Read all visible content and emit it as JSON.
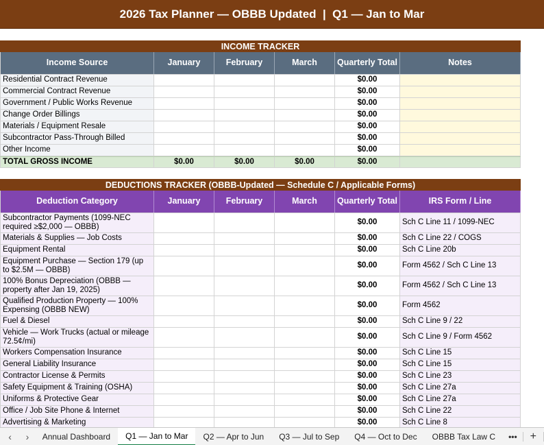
{
  "title": "2026 Tax Planner — OBBB Updated  |  Q1 — Jan to Mar",
  "income": {
    "section_title": "INCOME TRACKER",
    "headers": [
      "Income Source",
      "January",
      "February",
      "March",
      "Quarterly Total",
      "Notes"
    ],
    "rows": [
      {
        "label": "Residential Contract Revenue",
        "total": "$0.00"
      },
      {
        "label": "Commercial Contract Revenue",
        "total": "$0.00"
      },
      {
        "label": "Government / Public Works Revenue",
        "total": "$0.00"
      },
      {
        "label": "Change Order Billings",
        "total": "$0.00"
      },
      {
        "label": "Materials / Equipment Resale",
        "total": "$0.00"
      },
      {
        "label": "Subcontractor Pass-Through Billed",
        "total": "$0.00"
      },
      {
        "label": "Other Income",
        "total": "$0.00"
      }
    ],
    "total_row": {
      "label": "TOTAL GROSS INCOME",
      "jan": "$0.00",
      "feb": "$0.00",
      "mar": "$0.00",
      "total": "$0.00"
    }
  },
  "deductions": {
    "section_title": "DEDUCTIONS TRACKER (OBBB-Updated — Schedule C / Applicable Forms)",
    "headers": [
      "Deduction Category",
      "January",
      "February",
      "March",
      "Quarterly Total",
      "IRS Form / Line"
    ],
    "rows": [
      {
        "label": "Subcontractor Payments (1099-NEC required ≥$2,000 — OBBB)",
        "total": "$0.00",
        "form": "Sch C Line 11 / 1099-NEC",
        "tall": true
      },
      {
        "label": "Materials & Supplies — Job Costs",
        "total": "$0.00",
        "form": "Sch C Line 22 / COGS",
        "tall": false
      },
      {
        "label": "Equipment Rental",
        "total": "$0.00",
        "form": "Sch C Line 20b",
        "tall": false
      },
      {
        "label": "Equipment Purchase — Section 179 (up to $2.5M — OBBB)",
        "total": "$0.00",
        "form": "Form 4562 / Sch C Line 13",
        "tall": true
      },
      {
        "label": "100% Bonus Depreciation (OBBB — property after Jan 19, 2025)",
        "total": "$0.00",
        "form": "Form 4562 / Sch C Line 13",
        "tall": true
      },
      {
        "label": "Qualified Production Property — 100% Expensing (OBBB NEW)",
        "total": "$0.00",
        "form": "Form 4562",
        "tall": true
      },
      {
        "label": "Fuel & Diesel",
        "total": "$0.00",
        "form": "Sch C Line 9 / 22",
        "tall": false
      },
      {
        "label": "Vehicle — Work Trucks (actual or mileage 72.5¢/mi)",
        "total": "$0.00",
        "form": "Sch C Line 9 / Form 4562",
        "tall": true
      },
      {
        "label": "Workers Compensation Insurance",
        "total": "$0.00",
        "form": "Sch C Line 15",
        "tall": false
      },
      {
        "label": "General Liability Insurance",
        "total": "$0.00",
        "form": "Sch C Line 15",
        "tall": false
      },
      {
        "label": "Contractor License & Permits",
        "total": "$0.00",
        "form": "Sch C Line 23",
        "tall": false
      },
      {
        "label": "Safety Equipment & Training (OSHA)",
        "total": "$0.00",
        "form": "Sch C Line 27a",
        "tall": false
      },
      {
        "label": "Uniforms & Protective Gear",
        "total": "$0.00",
        "form": "Sch C Line 27a",
        "tall": false
      },
      {
        "label": "Office / Job Site Phone & Internet",
        "total": "$0.00",
        "form": "Sch C Line 22",
        "tall": false
      },
      {
        "label": "Advertising & Marketing",
        "total": "$0.00",
        "form": "Sch C Line 8",
        "tall": false
      }
    ]
  },
  "tabs": {
    "items": [
      "Annual Dashboard",
      "Q1 — Jan to Mar",
      "Q2 — Apr to Jun",
      "Q3 — Jul to Sep",
      "Q4 — Oct to Dec",
      "OBBB Tax Law C"
    ],
    "active_index": 1,
    "more": "•••",
    "add": "+"
  },
  "colors": {
    "banner": "#7b3e13",
    "income_header": "#5a6d80",
    "deduction_header": "#8145b0",
    "total_row": "#d9ead3",
    "notes_fill": "#fff9dd",
    "active_tab": "#107c41"
  }
}
